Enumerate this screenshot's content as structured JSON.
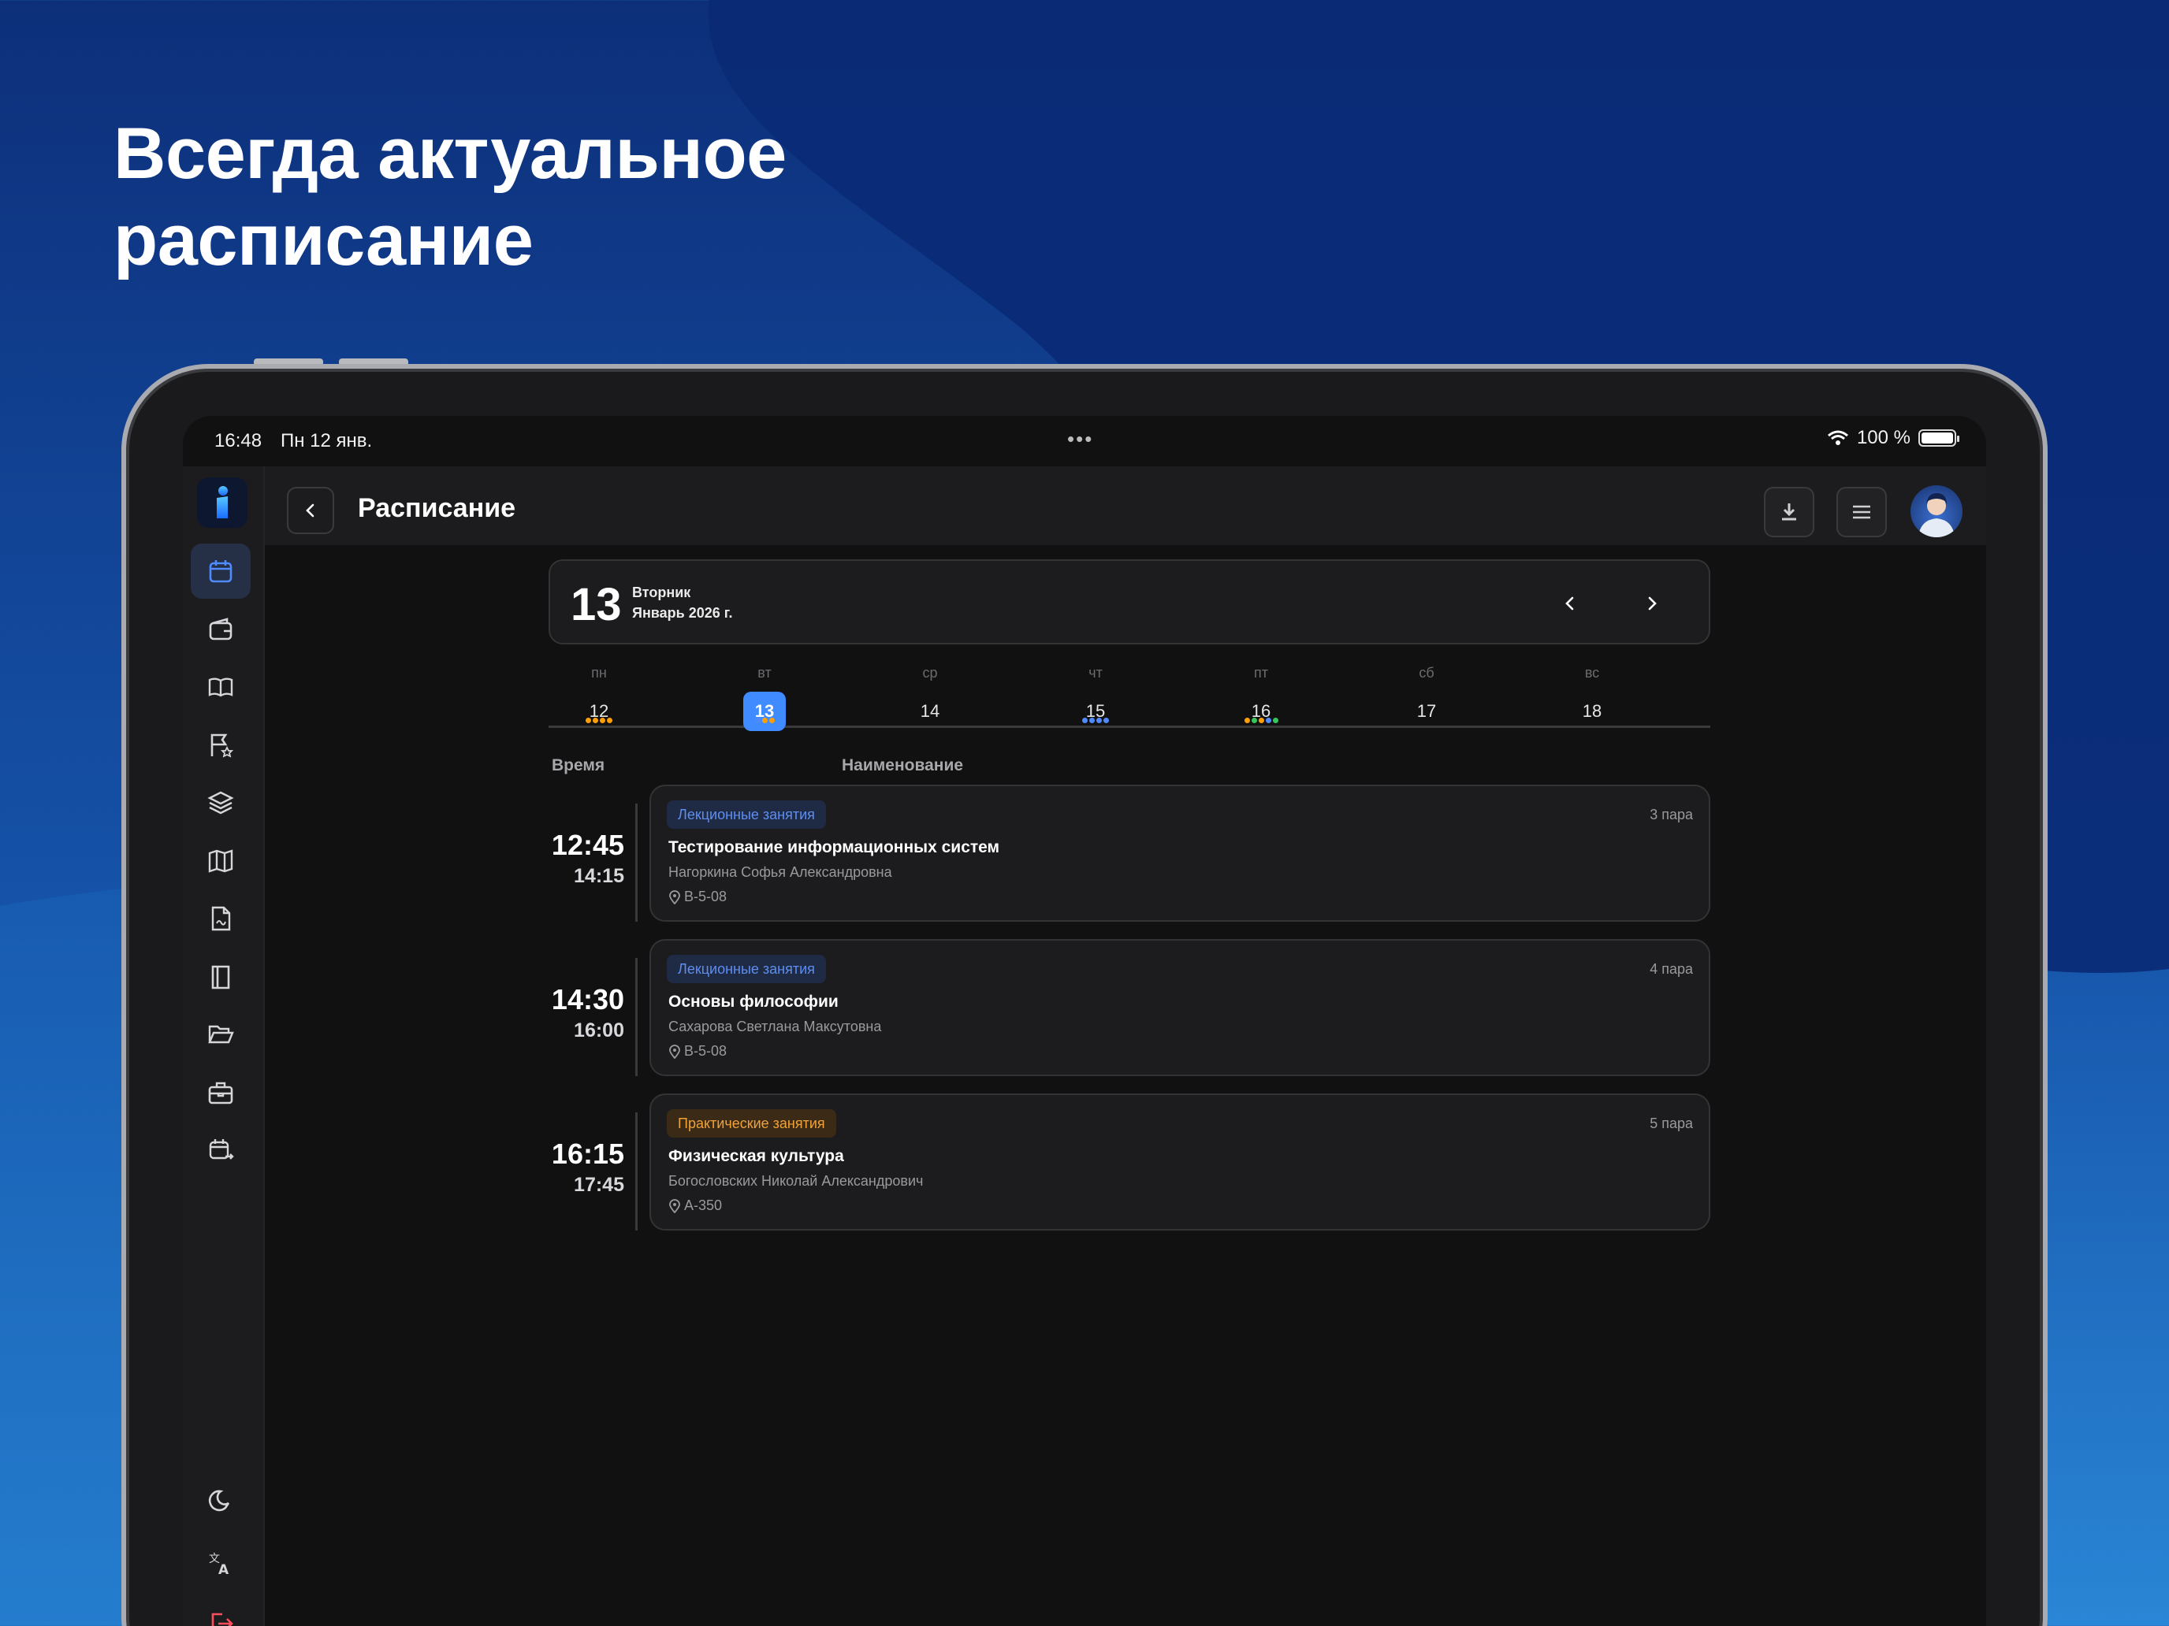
{
  "promo": {
    "title": "Всегда актуальное расписание"
  },
  "status_bar": {
    "time": "16:48",
    "date": "Пн 12 янв.",
    "battery": "100 %"
  },
  "sidebar": {
    "items": [
      {
        "icon": "calendar-icon",
        "active": true
      },
      {
        "icon": "wallet-icon"
      },
      {
        "icon": "open-book-icon"
      },
      {
        "icon": "flag-star-icon"
      },
      {
        "icon": "layers-icon"
      },
      {
        "icon": "map-icon"
      },
      {
        "icon": "document-icon"
      },
      {
        "icon": "book-icon"
      },
      {
        "icon": "folder-icon"
      },
      {
        "icon": "briefcase-icon"
      },
      {
        "icon": "calendar-swap-icon"
      }
    ],
    "bottom": [
      {
        "icon": "moon-icon"
      },
      {
        "icon": "translate-icon"
      },
      {
        "icon": "logout-icon",
        "color": "#ff4d5e"
      }
    ]
  },
  "header": {
    "title": "Расписание"
  },
  "date_card": {
    "day": "13",
    "weekday": "Вторник",
    "month_year": "Январь 2026 г."
  },
  "week": [
    {
      "name": "пн",
      "date": "12",
      "dots": [
        "#ff9f0a",
        "#ff9f0a",
        "#ff9f0a",
        "#ff9f0a"
      ]
    },
    {
      "name": "вт",
      "date": "13",
      "selected": true,
      "dots": [
        "#4f8bff",
        "#ff9f0a",
        "#ff9f0a"
      ]
    },
    {
      "name": "ср",
      "date": "14",
      "dots": []
    },
    {
      "name": "чт",
      "date": "15",
      "dots": [
        "#4f8bff",
        "#4f8bff",
        "#4f8bff",
        "#4f8bff"
      ]
    },
    {
      "name": "пт",
      "date": "16",
      "dots": [
        "#ff9f0a",
        "#34c759",
        "#ff9f0a",
        "#4f8bff",
        "#34c759"
      ]
    },
    {
      "name": "сб",
      "date": "17",
      "dots": []
    },
    {
      "name": "вс",
      "date": "18",
      "dots": []
    }
  ],
  "columns": {
    "time": "Время",
    "name": "Наименование"
  },
  "lessons": [
    {
      "start": "12:45",
      "end": "14:15",
      "type": "Лекционные занятия",
      "kind": "lec",
      "pair": "3 пара",
      "subject": "Тестирование информационных систем",
      "teacher": "Нагоркина Софья Александровна",
      "room": "В-5-08"
    },
    {
      "start": "14:30",
      "end": "16:00",
      "type": "Лекционные занятия",
      "kind": "lec",
      "pair": "4 пара",
      "subject": "Основы философии",
      "teacher": "Сахарова Светлана Максутовна",
      "room": "В-5-08"
    },
    {
      "start": "16:15",
      "end": "17:45",
      "type": "Практические занятия",
      "kind": "prac",
      "pair": "5 пара",
      "subject": "Физическая культура",
      "teacher": "Богословских Николай Александрович",
      "room": "А-350"
    }
  ]
}
